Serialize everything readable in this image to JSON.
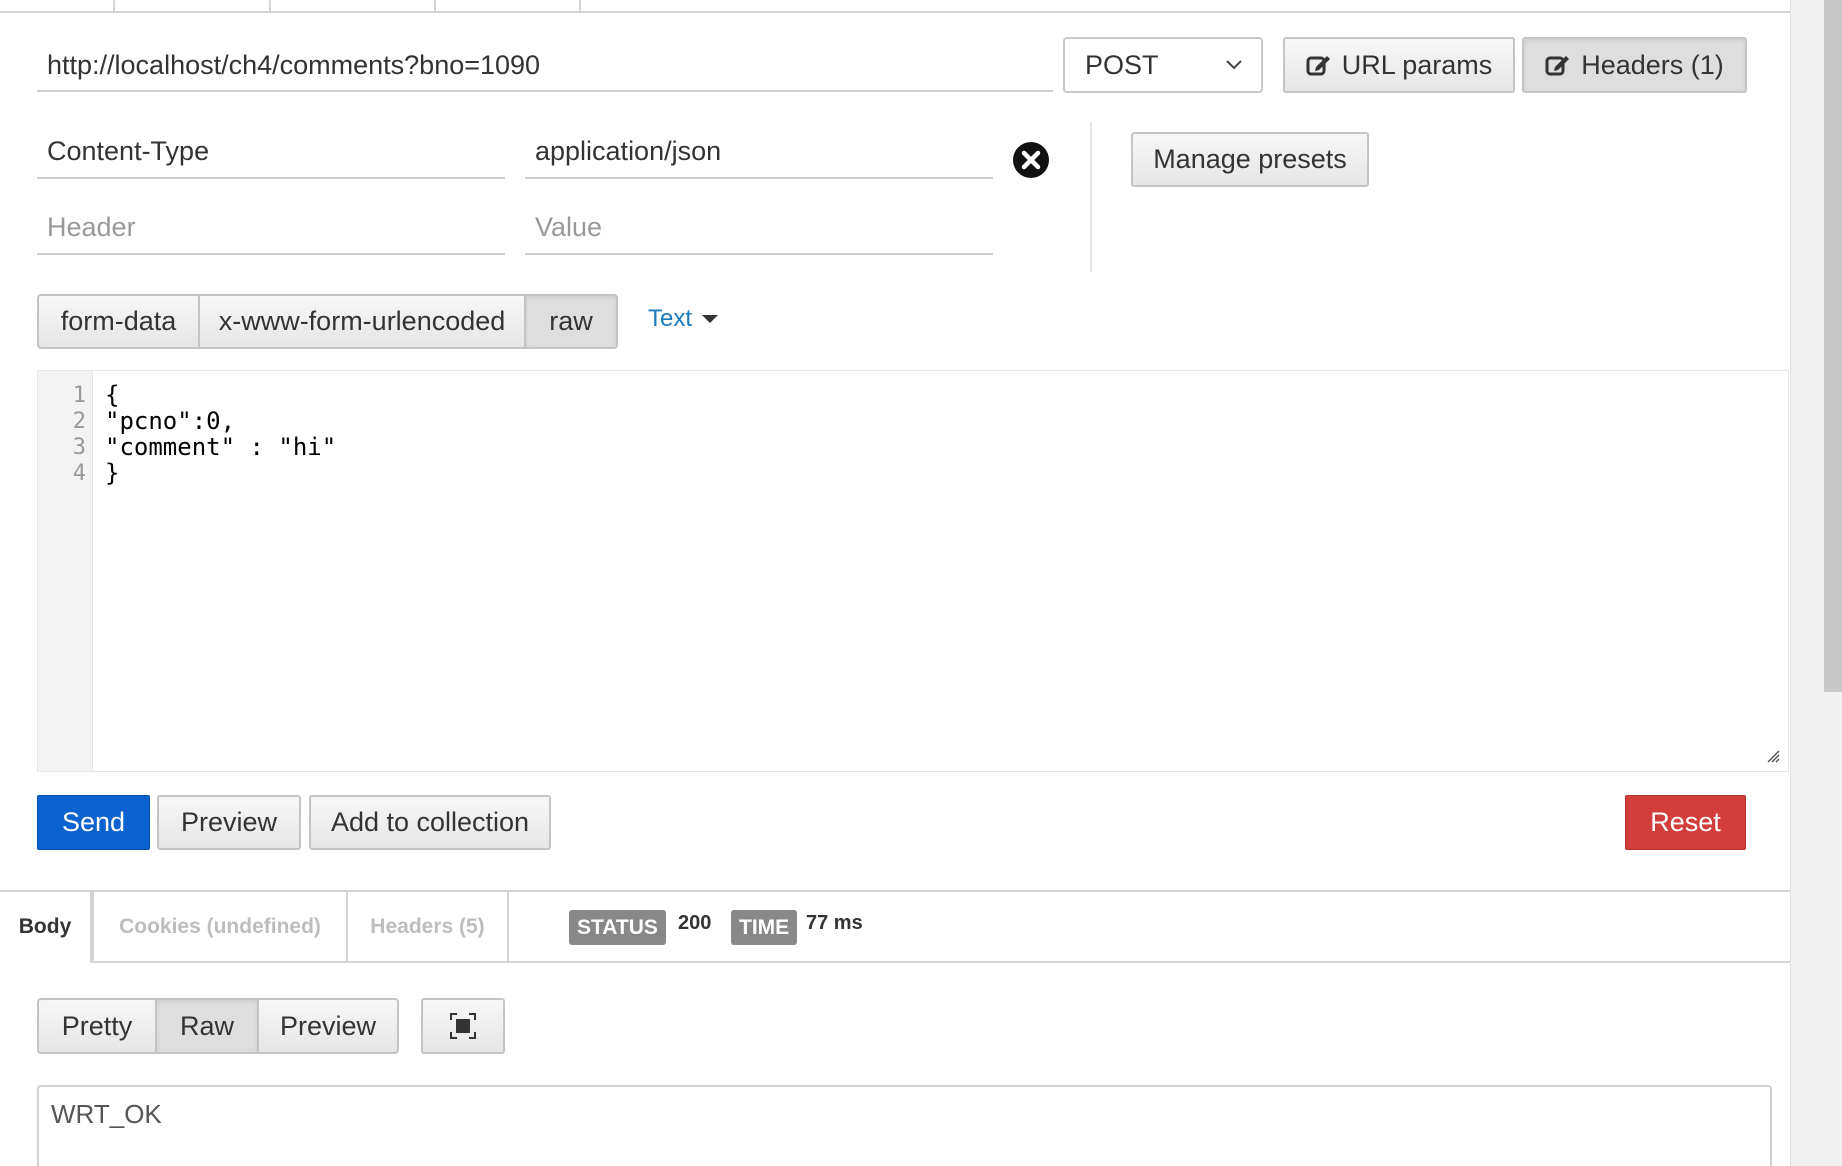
{
  "request": {
    "url": "http://localhost/ch4/comments?bno=1090",
    "method": "POST",
    "url_params_label": "URL params",
    "headers_label": "Headers (1)"
  },
  "headers": {
    "rows": [
      {
        "key": "Content-Type",
        "value": "application/json"
      }
    ],
    "key_placeholder": "Header",
    "value_placeholder": "Value",
    "manage_presets_label": "Manage presets"
  },
  "body_mode": {
    "options": [
      "form-data",
      "x-www-form-urlencoded",
      "raw"
    ],
    "selected": "raw",
    "format": "Text"
  },
  "editor": {
    "line_numbers": [
      "1",
      "2",
      "3",
      "4"
    ],
    "lines": [
      "{",
      "\"pcno\":0,",
      "\"comment\" : \"hi\"",
      "}"
    ]
  },
  "actions": {
    "send": "Send",
    "preview": "Preview",
    "add_to_collection": "Add to collection",
    "reset": "Reset"
  },
  "response": {
    "tabs": [
      "Body",
      "Cookies (undefined)",
      "Headers (5)"
    ],
    "status_label": "STATUS",
    "status_value": "200",
    "time_label": "TIME",
    "time_value": "77 ms",
    "view_modes": [
      "Pretty",
      "Raw",
      "Preview"
    ],
    "selected_view": "Raw",
    "body_text": "WRT_OK"
  },
  "colors": {
    "send": "#0a62cf",
    "reset": "#d23f3a",
    "link": "#1a7bbf",
    "badge": "#888888"
  }
}
